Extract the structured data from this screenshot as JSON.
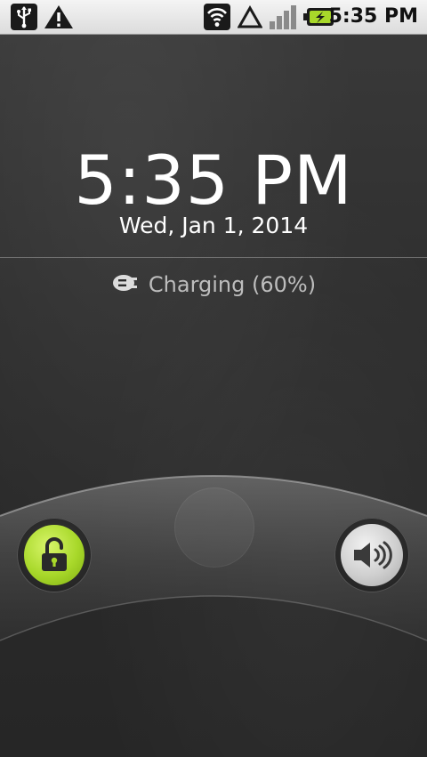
{
  "status_bar": {
    "time": "5:35 PM",
    "icons": [
      "usb-icon",
      "warning-icon",
      "wifi-icon",
      "data-triangle-icon",
      "signal-icon",
      "battery-charging-icon"
    ]
  },
  "lockscreen": {
    "clock": "5:35 PM",
    "date": "Wed, Jan 1, 2014",
    "charging_text": "Charging (60%)",
    "battery_level_percent": 60
  },
  "controls": {
    "unlock_icon": "unlock-icon",
    "sound_icon": "sound-on-icon"
  },
  "colors": {
    "accent_green": "#a8d82a",
    "status_bar_bg": "#e8e8e8",
    "charging_text": "#bdbdbd"
  }
}
